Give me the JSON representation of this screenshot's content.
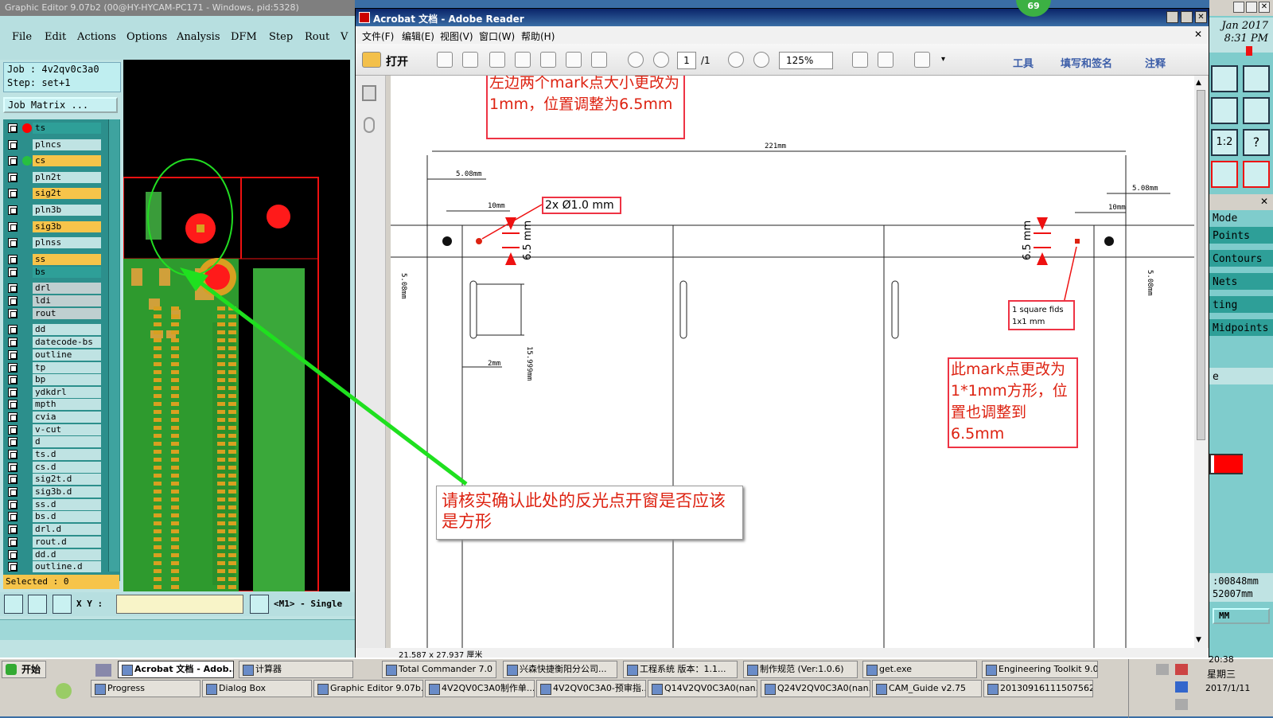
{
  "graphic_editor": {
    "title": "Graphic Editor 9.07b2 (00@HY-HYCAM-PC171 - Windows, pid:5328)",
    "menu": [
      "File",
      "Edit",
      "Actions",
      "Options",
      "Analysis",
      "DFM",
      "Step",
      "Rout",
      "V"
    ],
    "job_line": "Job  : 4v2qv0c3a0",
    "step_line": "Step: set+1",
    "job_matrix_label": "Job Matrix ...",
    "layers": [
      {
        "name": "ts",
        "color": "#2e9f98",
        "dot": "#ff0000"
      },
      {
        "name": "plncs",
        "color": "#bfe3e3"
      },
      {
        "name": "cs",
        "color": "#f6c44a",
        "dot": "#28c040"
      },
      {
        "name": "pln2t",
        "color": "#bfe3e3"
      },
      {
        "name": "sig2t",
        "color": "#f6c44a"
      },
      {
        "name": "pln3b",
        "color": "#bfe3e3"
      },
      {
        "name": "sig3b",
        "color": "#f6c44a"
      },
      {
        "name": "plnss",
        "color": "#bfe3e3"
      },
      {
        "name": "ss",
        "color": "#f6c44a"
      },
      {
        "name": "bs",
        "color": "#2e9f98"
      },
      {
        "name": "drl",
        "color": "#bfcfd0"
      },
      {
        "name": "ldi",
        "color": "#bfcfd0"
      },
      {
        "name": "rout",
        "color": "#bfcfd0"
      },
      {
        "name": "dd",
        "color": "#bfe3e3"
      },
      {
        "name": "datecode-bs",
        "color": "#bfe3e3"
      },
      {
        "name": "outline",
        "color": "#bfe3e3"
      },
      {
        "name": "tp",
        "color": "#bfe3e3"
      },
      {
        "name": "bp",
        "color": "#bfe3e3"
      },
      {
        "name": "ydkdrl",
        "color": "#bfe3e3"
      },
      {
        "name": "mpth",
        "color": "#bfe3e3"
      },
      {
        "name": "cvia",
        "color": "#bfe3e3"
      },
      {
        "name": "v-cut",
        "color": "#bfe3e3"
      },
      {
        "name": "d",
        "color": "#bfe3e3"
      },
      {
        "name": "ts.d",
        "color": "#bfe3e3"
      },
      {
        "name": "cs.d",
        "color": "#bfe3e3"
      },
      {
        "name": "sig2t.d",
        "color": "#bfe3e3"
      },
      {
        "name": "sig3b.d",
        "color": "#bfe3e3"
      },
      {
        "name": "ss.d",
        "color": "#bfe3e3"
      },
      {
        "name": "bs.d",
        "color": "#bfe3e3"
      },
      {
        "name": "drl.d",
        "color": "#bfe3e3"
      },
      {
        "name": "rout.d",
        "color": "#bfe3e3"
      },
      {
        "name": "dd.d",
        "color": "#bfe3e3"
      },
      {
        "name": "outline.d",
        "color": "#bfe3e3"
      }
    ],
    "selected": "Selected : 0",
    "xy_label": "X Y :",
    "mode_text": "<M1> - Single"
  },
  "right_panel": {
    "date": "Jan 2017",
    "time": "8:31 PM",
    "items": [
      "Mode",
      "Points",
      "Contours",
      "Nets",
      "ting",
      "Midpoints"
    ],
    "item_e": "e",
    "coord1": ":00848mm",
    "coord2": "52007mm",
    "unit": "MM"
  },
  "acrobat": {
    "title": "Acrobat 文档 - Adobe Reader",
    "badge": "69",
    "menu": [
      "文件(F)",
      "编辑(E)",
      "视图(V)",
      "窗口(W)",
      "帮助(H)"
    ],
    "open_label": "打开",
    "page_current": "1",
    "page_total": "/1",
    "zoom": "125%",
    "tools": "工具",
    "fill_sign": "填写和签名",
    "comment": "注释",
    "page_size": "21.587 x 27.937 厘米"
  },
  "document": {
    "note_top": "左边两个mark点大小更改为1mm，位置调整为6.5mm",
    "note_right": "此mark点更改为1*1mm方形，位置也调整到6.5mm",
    "note_popup": "请核实确认此处的反光点开窗是否应该是方形",
    "label_2x": "2x Ø1.0 mm",
    "label_square_1": "1 square fids",
    "label_square_2": "1x1 mm",
    "dim_221": "221mm",
    "dim_508_left": "5.08mm",
    "dim_508_right": "5.08mm",
    "dim_10_left": "10mm",
    "dim_10_right": "10mm",
    "dim_65_left": "6.5 mm",
    "dim_65_right": "6.5 mm",
    "dim_2mm": "2mm",
    "dim_15999": "15.999mm",
    "dim_508_vert_left": "5.08mm",
    "dim_508_vert_right": "5.08mm"
  },
  "taskbar": {
    "start": "开始",
    "row1": [
      "Acrobat 文档 - Adob...",
      "计算器",
      "Total Commander 7.0 p...",
      "兴森快捷衡阳分公司...",
      "工程系统  版本：1.1...",
      "制作规范 (Ver:1.0.6)",
      "get.exe",
      "Engineering Toolkit 9.0..."
    ],
    "row2": [
      "Progress",
      "Dialog Box",
      "Graphic Editor 9.07b...",
      "4V2QV0C3A0制作单...",
      "4V2QV0C3A0-预审指...",
      "Q14V2QV0C3A0(nan...",
      "Q24V2QV0C3A0(nan...",
      "CAM_Guide v2.75",
      "20130916111507562..."
    ],
    "clock_time": "20:38",
    "clock_day": "星期三",
    "clock_date": "2017/1/11"
  }
}
